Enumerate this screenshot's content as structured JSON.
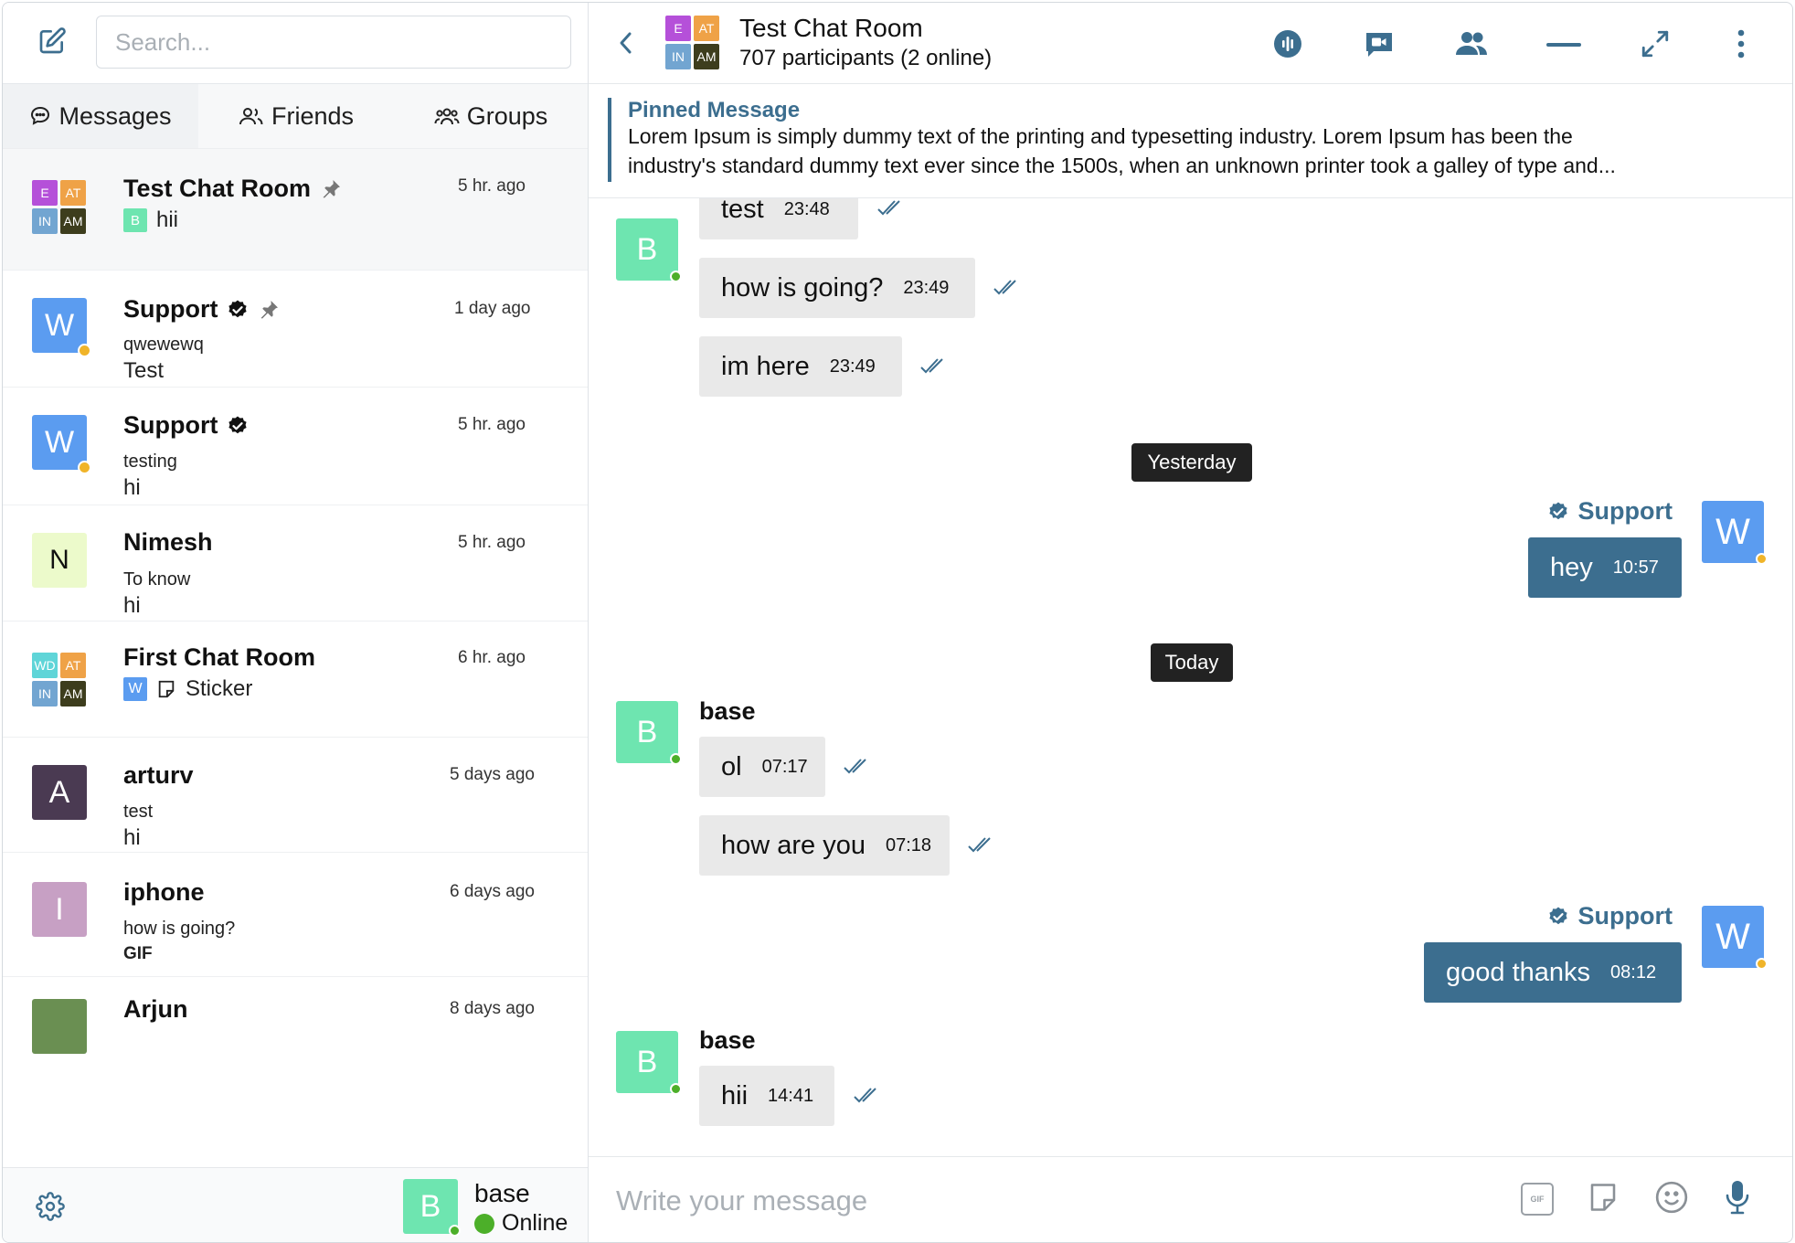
{
  "sidebar": {
    "search_placeholder": "Search...",
    "tabs": [
      {
        "label": "Messages"
      },
      {
        "label": "Friends"
      },
      {
        "label": "Groups"
      }
    ],
    "conversations": [
      {
        "name": "Test Chat Room",
        "time": "5 hr. ago",
        "avatar": {
          "type": "grid",
          "cells": [
            "E",
            "AT",
            "IN",
            "AM"
          ]
        },
        "last_sender_initial": "B",
        "message": "hii",
        "pinned": true
      },
      {
        "name": "Support",
        "time": "1 day ago",
        "avatar": {
          "type": "letter",
          "letter": "W"
        },
        "verified": true,
        "pinned": true,
        "subtitle": "qwewewq",
        "message": "Test"
      },
      {
        "name": "Support",
        "time": "5 hr. ago",
        "avatar": {
          "type": "letter",
          "letter": "W"
        },
        "verified": true,
        "subtitle": "testing",
        "message": "hi"
      },
      {
        "name": "Nimesh",
        "time": "5 hr. ago",
        "avatar": {
          "type": "letter",
          "letter": "N"
        },
        "subtitle": "To know",
        "message": "hi"
      },
      {
        "name": "First Chat Room",
        "time": "6 hr. ago",
        "avatar": {
          "type": "grid",
          "cells": [
            "WD",
            "AT",
            "IN",
            "AM"
          ]
        },
        "last_sender_initial": "W",
        "message": "Sticker"
      },
      {
        "name": "arturv",
        "time": "5 days ago",
        "avatar": {
          "type": "letter",
          "letter": "A"
        },
        "subtitle": "test",
        "message": "hi"
      },
      {
        "name": "iphone",
        "time": "6 days ago",
        "avatar": {
          "type": "letter",
          "letter": "I"
        },
        "subtitle": "how is going?",
        "message": "GIF"
      },
      {
        "name": "Arjun",
        "time": "8 days ago",
        "avatar": {
          "type": "letter",
          "letter": ""
        }
      }
    ],
    "current_user": {
      "initial": "B",
      "name": "base",
      "status": "Online"
    }
  },
  "chat": {
    "title": "Test Chat Room",
    "participants": "707 participants (2 online)",
    "avatar_cells": [
      "E",
      "AT",
      "IN",
      "AM"
    ],
    "pinned": {
      "label": "Pinned Message",
      "line1": "Lorem Ipsum is simply dummy text of the printing and typesetting industry. Lorem Ipsum has been the",
      "line2": "industry's standard dummy text ever since the 1500s, when an unknown printer took a galley of type and..."
    },
    "messages": [
      {
        "text": "test",
        "time": "23:48"
      },
      {
        "text": "how is going?",
        "time": "23:49"
      },
      {
        "text": "im here",
        "time": "23:49"
      },
      {
        "text": "hey",
        "time": "10:57",
        "sender": "Support"
      },
      {
        "text": "ol",
        "time": "07:17",
        "sender": "base"
      },
      {
        "text": "how are you",
        "time": "07:18"
      },
      {
        "text": "good thanks",
        "time": "08:12",
        "sender": "Support"
      },
      {
        "text": "hii",
        "time": "14:41",
        "sender": "base"
      }
    ],
    "dates": {
      "yesterday": "Yesterday",
      "today": "Today"
    },
    "avatar_initials": {
      "base": "B",
      "support": "W"
    },
    "composer_placeholder": "Write your message",
    "gif_label": "GIF"
  },
  "colors": {
    "accent": "#3c6e8f",
    "base_avatar": "#6ee5b0",
    "support_avatar": "#5b9cf0",
    "online": "#4caf29",
    "away": "#f0b429"
  }
}
